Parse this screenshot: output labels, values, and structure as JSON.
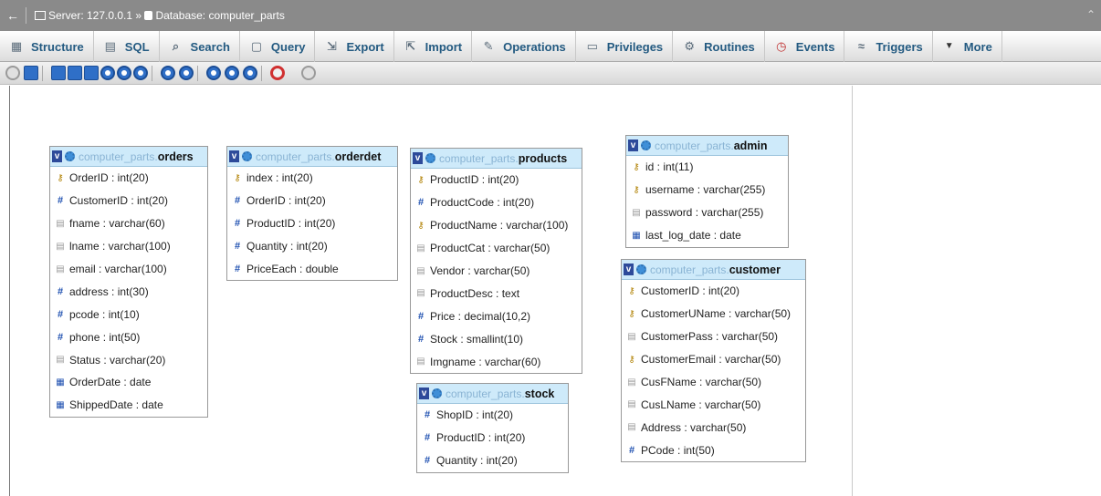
{
  "topbar": {
    "server_label": "Server: 127.0.0.1",
    "separator": "»",
    "database_label": "Database: computer_parts"
  },
  "tabs": [
    {
      "label": "Structure",
      "icon": "structure-icon"
    },
    {
      "label": "SQL",
      "icon": "sql-icon"
    },
    {
      "label": "Search",
      "icon": "search-icon"
    },
    {
      "label": "Query",
      "icon": "query-icon"
    },
    {
      "label": "Export",
      "icon": "export-icon"
    },
    {
      "label": "Import",
      "icon": "import-icon"
    },
    {
      "label": "Operations",
      "icon": "wrench-icon"
    },
    {
      "label": "Privileges",
      "icon": "privileges-icon"
    },
    {
      "label": "Routines",
      "icon": "routines-icon"
    },
    {
      "label": "Events",
      "icon": "clock-icon"
    },
    {
      "label": "Triggers",
      "icon": "triggers-icon"
    },
    {
      "label": "More",
      "icon": "triangle-down-icon"
    }
  ],
  "toolbar": {
    "buttons": [
      "toggle-menu-icon",
      "fullscreen-icon",
      "save-icon",
      "load-icon",
      "relation-icon",
      "toggle-grid-icon",
      "angular-links-icon",
      "snap-grid-icon",
      "small-big-icon",
      "toggle-all-icon",
      "toggle-direction-icon",
      "move-menu-icon",
      "pin-icon",
      "export-schema-icon",
      "collapse-icon"
    ]
  },
  "tables": [
    {
      "db": "computer_parts.",
      "name": "orders",
      "columns": [
        {
          "type": "key",
          "text": "OrderID : int(20)"
        },
        {
          "type": "num",
          "text": "CustomerID : int(20)"
        },
        {
          "type": "txt",
          "text": "fname : varchar(60)"
        },
        {
          "type": "txt",
          "text": "lname : varchar(100)"
        },
        {
          "type": "txt",
          "text": "email : varchar(100)"
        },
        {
          "type": "num",
          "text": "address : int(30)"
        },
        {
          "type": "num",
          "text": "pcode : int(10)"
        },
        {
          "type": "num",
          "text": "phone : int(50)"
        },
        {
          "type": "txt",
          "text": "Status : varchar(20)"
        },
        {
          "type": "date",
          "text": "OrderDate : date"
        },
        {
          "type": "date",
          "text": "ShippedDate : date"
        }
      ]
    },
    {
      "db": "computer_parts.",
      "name": "orderdet",
      "columns": [
        {
          "type": "key",
          "text": "index : int(20)"
        },
        {
          "type": "num",
          "text": "OrderID : int(20)"
        },
        {
          "type": "num",
          "text": "ProductID : int(20)"
        },
        {
          "type": "num",
          "text": "Quantity : int(20)"
        },
        {
          "type": "num",
          "text": "PriceEach : double"
        }
      ]
    },
    {
      "db": "computer_parts.",
      "name": "products",
      "columns": [
        {
          "type": "key",
          "text": "ProductID : int(20)"
        },
        {
          "type": "num",
          "text": "ProductCode : int(20)"
        },
        {
          "type": "key",
          "text": "ProductName : varchar(100)"
        },
        {
          "type": "txt",
          "text": "ProductCat : varchar(50)"
        },
        {
          "type": "txt",
          "text": "Vendor : varchar(50)"
        },
        {
          "type": "txt",
          "text": "ProductDesc : text"
        },
        {
          "type": "num",
          "text": "Price : decimal(10,2)"
        },
        {
          "type": "num",
          "text": "Stock : smallint(10)"
        },
        {
          "type": "txt",
          "text": "Imgname : varchar(60)"
        }
      ]
    },
    {
      "db": "computer_parts.",
      "name": "admin",
      "columns": [
        {
          "type": "key",
          "text": "id : int(11)"
        },
        {
          "type": "key",
          "text": "username : varchar(255)"
        },
        {
          "type": "txt",
          "text": "password : varchar(255)"
        },
        {
          "type": "date",
          "text": "last_log_date : date"
        }
      ]
    },
    {
      "db": "computer_parts.",
      "name": "customer",
      "columns": [
        {
          "type": "key",
          "text": "CustomerID : int(20)"
        },
        {
          "type": "key",
          "text": "CustomerUName : varchar(50)"
        },
        {
          "type": "txt",
          "text": "CustomerPass : varchar(50)"
        },
        {
          "type": "key",
          "text": "CustomerEmail : varchar(50)"
        },
        {
          "type": "txt",
          "text": "CusFName : varchar(50)"
        },
        {
          "type": "txt",
          "text": "CusLName : varchar(50)"
        },
        {
          "type": "txt",
          "text": "Address : varchar(50)"
        },
        {
          "type": "num",
          "text": "PCode : int(50)"
        }
      ]
    },
    {
      "db": "computer_parts.",
      "name": "stock",
      "columns": [
        {
          "type": "num",
          "text": "ShopID : int(20)"
        },
        {
          "type": "num",
          "text": "ProductID : int(20)"
        },
        {
          "type": "num",
          "text": "Quantity : int(20)"
        }
      ]
    }
  ]
}
